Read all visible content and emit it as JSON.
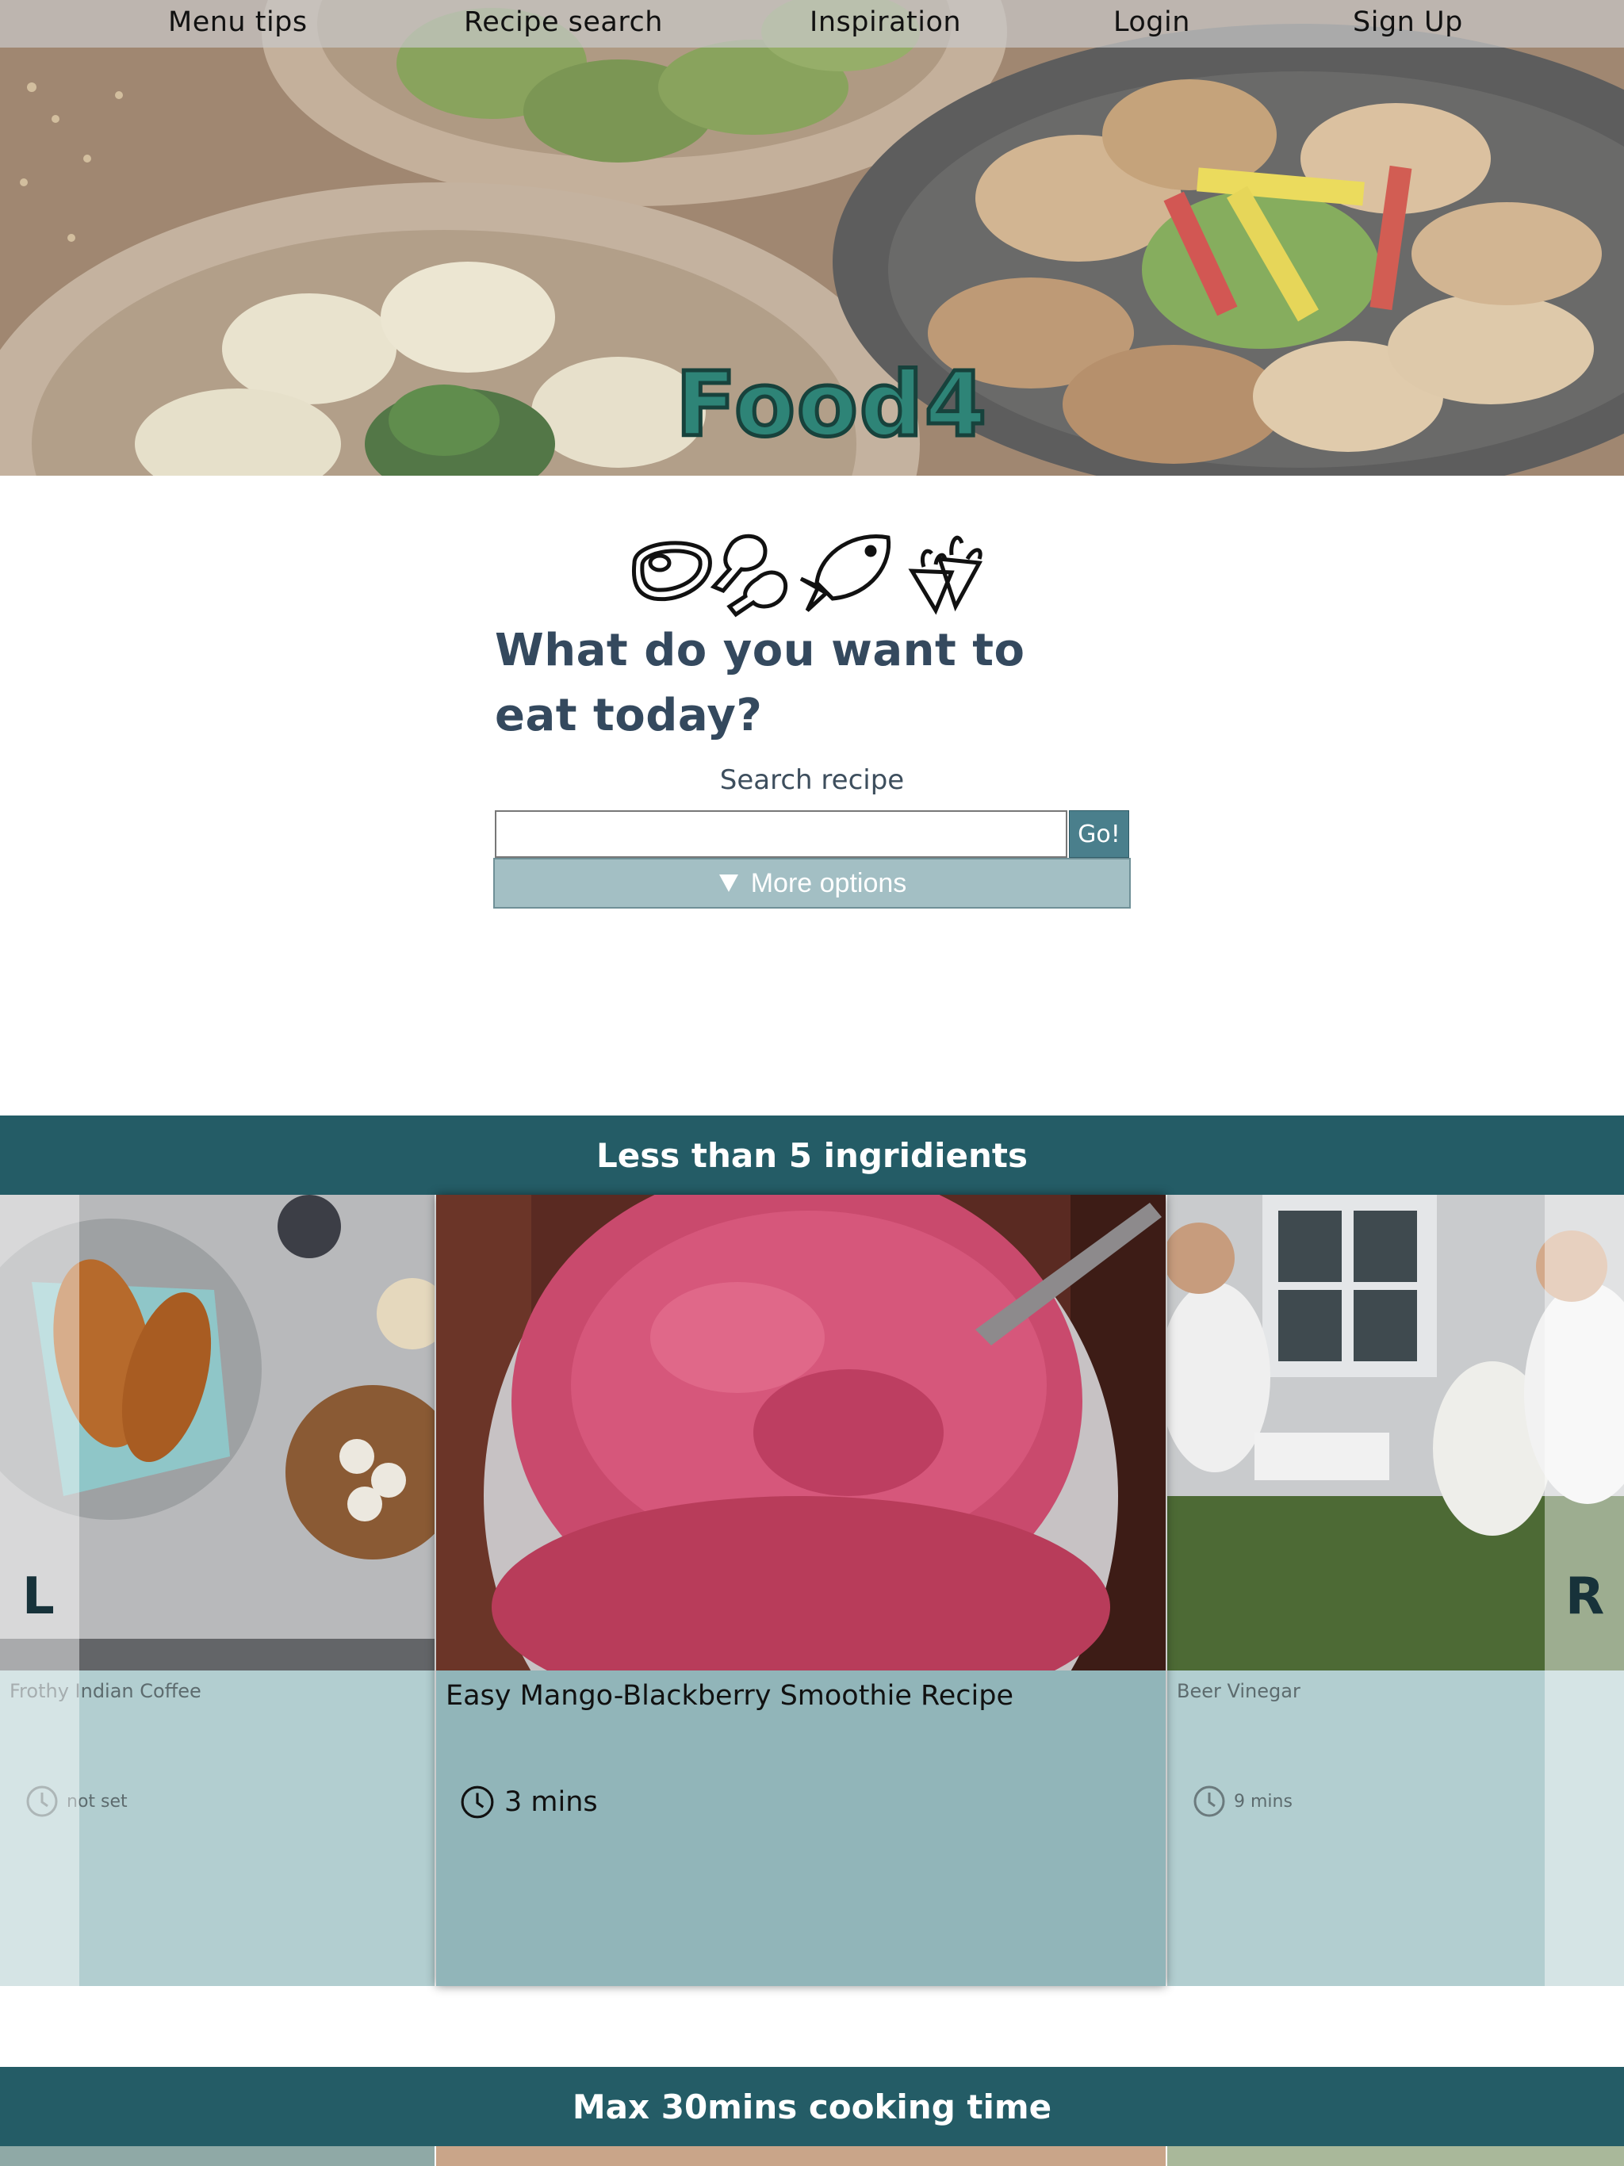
{
  "nav": {
    "items": [
      "Menu tips",
      "Recipe search",
      "Inspiration",
      "Login",
      "Sign Up"
    ]
  },
  "brand": {
    "logo": "Food4",
    "accent": "#2e8477"
  },
  "search": {
    "headline": "What do you want to eat today?",
    "label": "Search recipe",
    "value": "",
    "placeholder": "",
    "go": "Go!",
    "more_options": "More options",
    "more_icon": "triangle-down-icon"
  },
  "sections": [
    {
      "title": "Less than 5 ingridients",
      "arrow_left": "L",
      "arrow_right": "R",
      "cards": [
        {
          "title": "Frothy Indian Coffee",
          "time": "not set"
        },
        {
          "title": "Easy Mango-Blackberry Smoothie Recipe",
          "time": "3 mins"
        },
        {
          "title": "Beer Vinegar",
          "time": "9 mins"
        }
      ]
    },
    {
      "title": "Max 30mins cooking time"
    }
  ],
  "colors": {
    "section_bar": "#245c66",
    "card": "#b2ced0",
    "card_active": "#91b5b9",
    "go_button": "#4a7f8c"
  }
}
